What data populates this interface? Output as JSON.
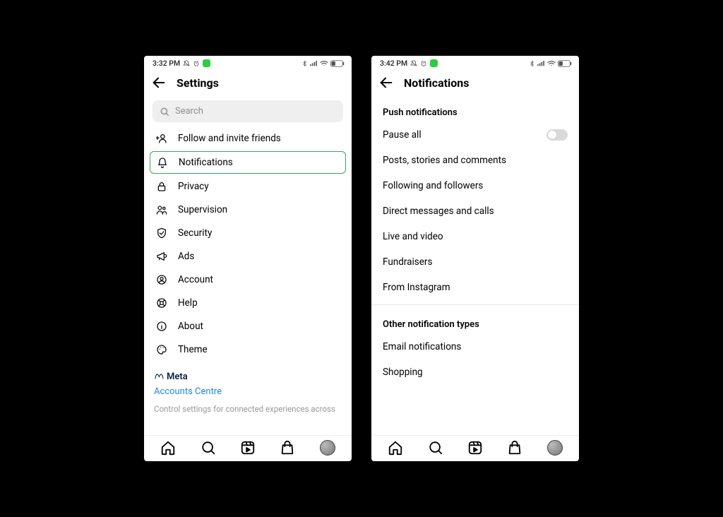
{
  "screen1": {
    "status": {
      "time": "3:32 PM"
    },
    "header": {
      "title": "Settings"
    },
    "search": {
      "placeholder": "Search"
    },
    "items": [
      {
        "label": "Follow and invite friends",
        "icon": "user-plus-icon"
      },
      {
        "label": "Notifications",
        "icon": "bell-icon",
        "highlighted": true
      },
      {
        "label": "Privacy",
        "icon": "lock-icon"
      },
      {
        "label": "Supervision",
        "icon": "supervision-icon"
      },
      {
        "label": "Security",
        "icon": "shield-icon"
      },
      {
        "label": "Ads",
        "icon": "megaphone-icon"
      },
      {
        "label": "Account",
        "icon": "account-icon"
      },
      {
        "label": "Help",
        "icon": "help-icon"
      },
      {
        "label": "About",
        "icon": "info-icon"
      },
      {
        "label": "Theme",
        "icon": "palette-icon"
      }
    ],
    "meta_label": "Meta",
    "accounts_centre": "Accounts Centre",
    "footnote": "Control settings for connected experiences across"
  },
  "screen2": {
    "status": {
      "time": "3:42 PM"
    },
    "header": {
      "title": "Notifications"
    },
    "section1_title": "Push notifications",
    "pause_all_label": "Pause all",
    "push_items": [
      "Posts, stories and comments",
      "Following and followers",
      "Direct messages and calls",
      "Live and video",
      "Fundraisers",
      "From Instagram"
    ],
    "section2_title": "Other notification types",
    "other_items": [
      "Email notifications",
      "Shopping"
    ]
  },
  "bottombar": {
    "items": [
      "home",
      "search",
      "reels",
      "shop",
      "profile"
    ]
  }
}
